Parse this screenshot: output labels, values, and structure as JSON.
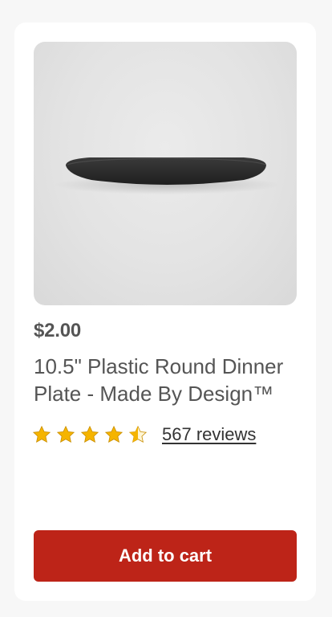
{
  "product": {
    "price": "$2.00",
    "title": "10.5\" Plastic Round Dinner Plate - Made By Design™",
    "image_alt": "dark gray round dinner plate",
    "rating": {
      "value": 4.5,
      "max": 5,
      "reviews_label": "567 reviews",
      "star_color": "#f5b400"
    }
  },
  "actions": {
    "add_to_cart_label": "Add to cart",
    "button_color": "#bd2418"
  }
}
